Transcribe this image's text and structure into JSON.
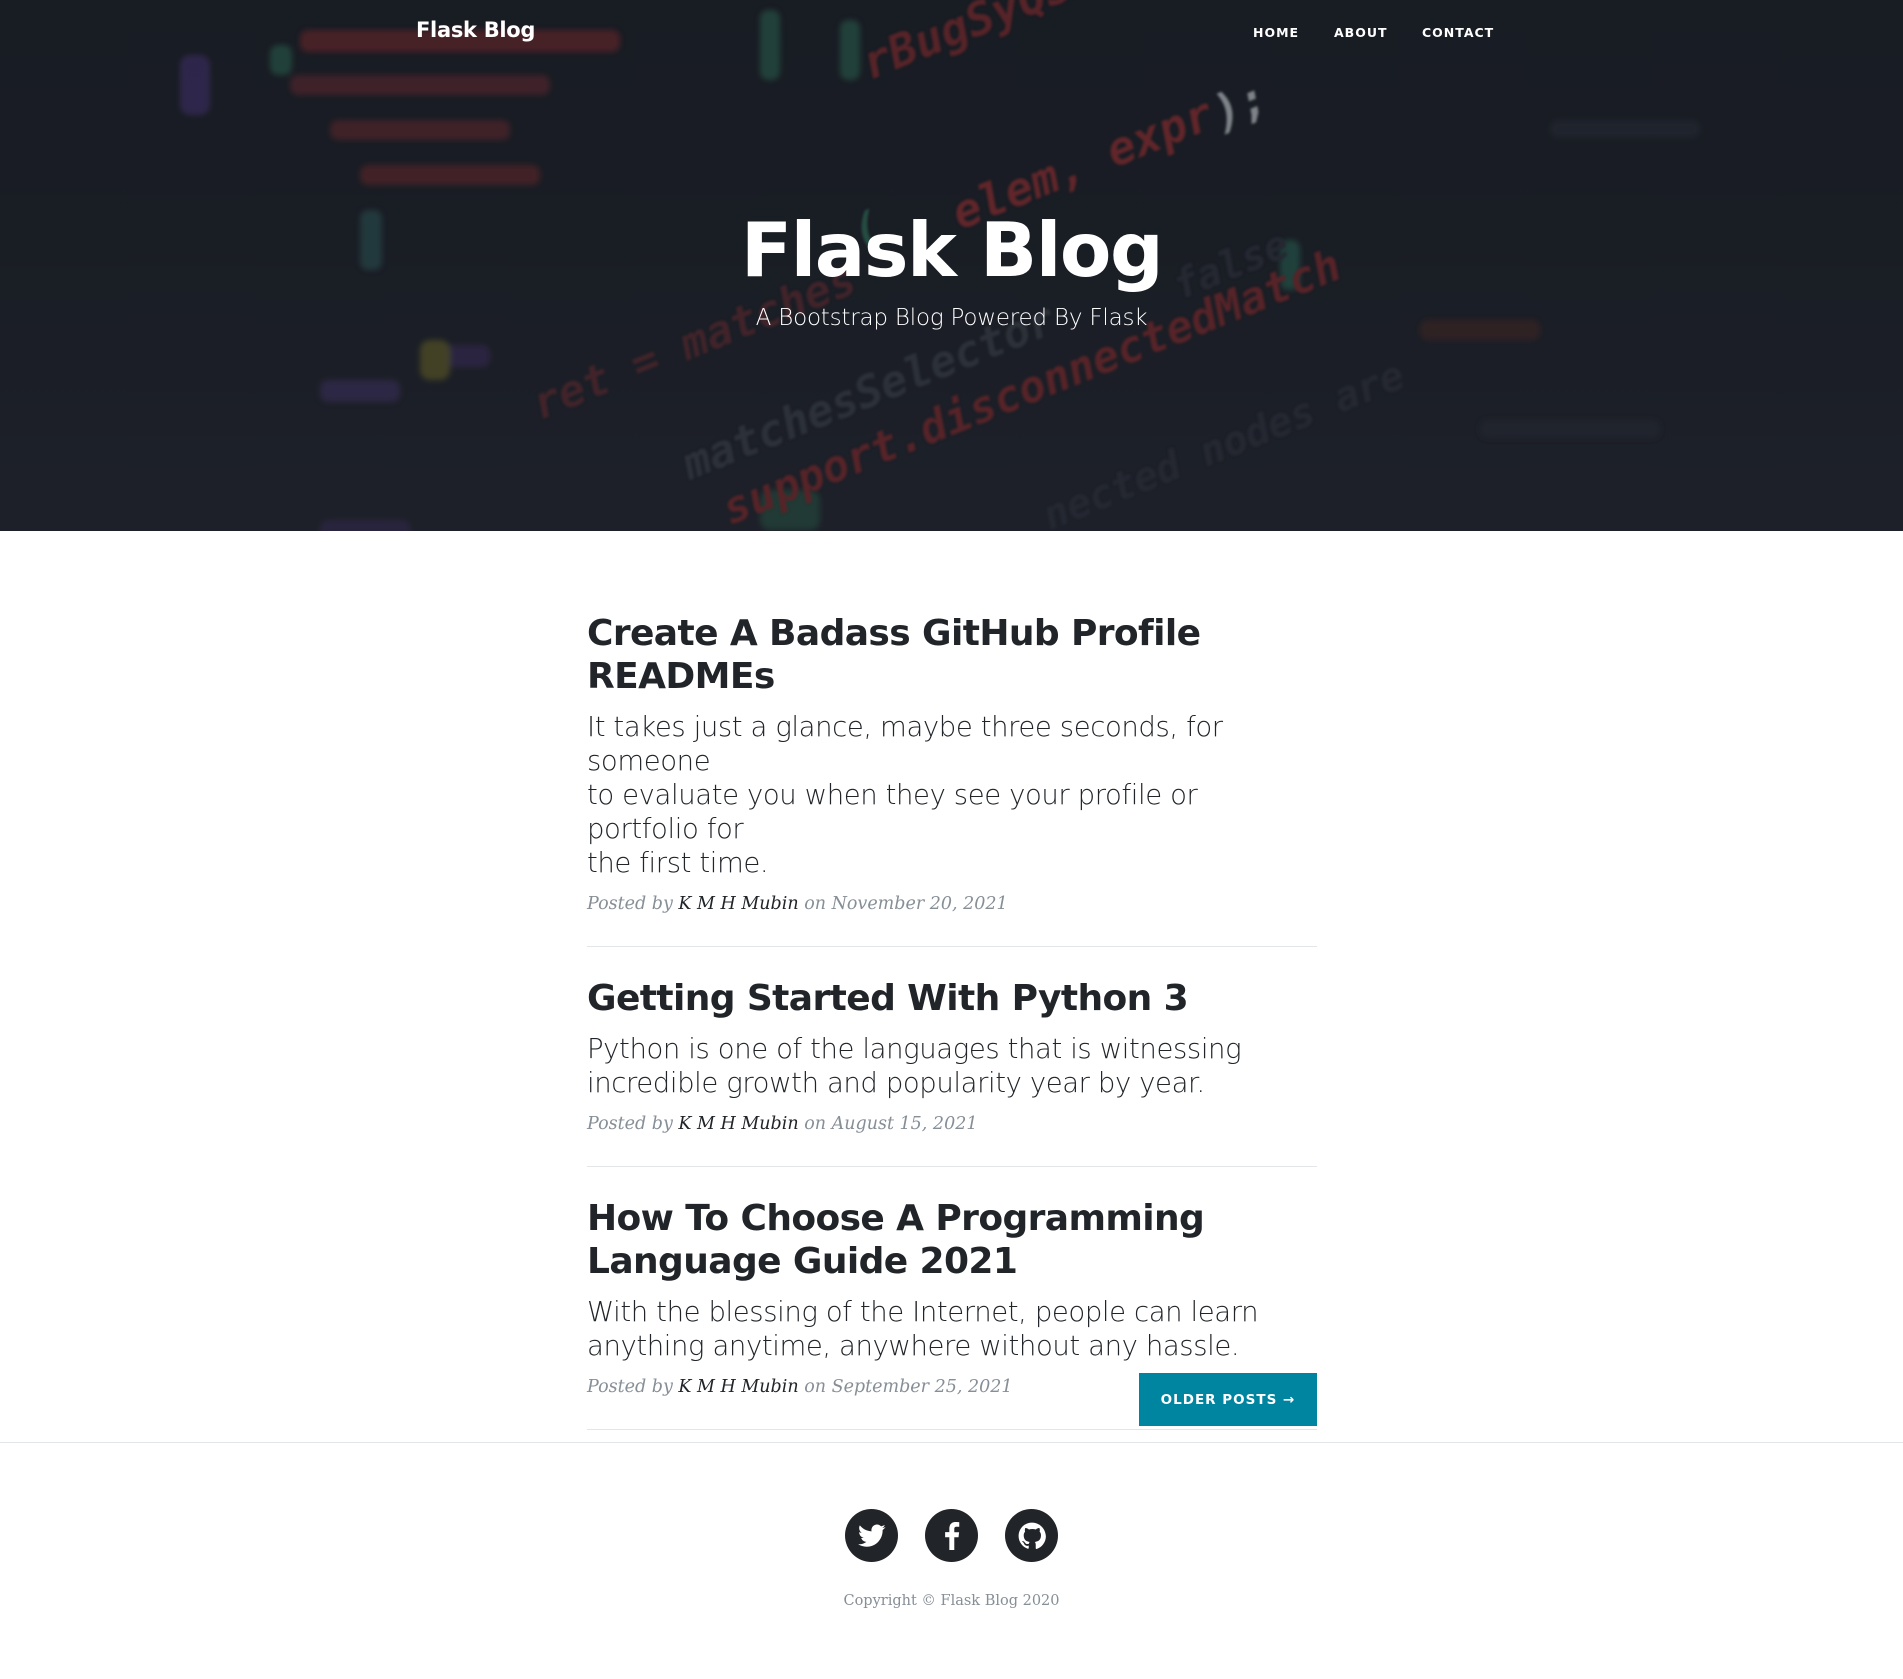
{
  "navbar": {
    "brand": "Flask Blog",
    "links": [
      "HOME",
      "ABOUT",
      "CONTACT"
    ]
  },
  "hero": {
    "title": "Flask Blog",
    "subtitle": "A Bootstrap Blog Powered By Flask"
  },
  "posts": [
    {
      "title_line1": "Create A Badass GitHub Profile",
      "title_line2": "READMEs",
      "subtitle_line1": "It takes just a glance, maybe three seconds, for someone",
      "subtitle_line2": "to evaluate you when they see your profile or portfolio for",
      "subtitle_line3": "the first time.",
      "meta_prefix": "Posted by",
      "author": "K M H Mubin",
      "meta_on": "on",
      "date": "November 20, 2021"
    },
    {
      "title_line1": "Getting Started With Python 3",
      "subtitle_line1": "Python is one of the languages that is witnessing",
      "subtitle_line2": "incredible growth and popularity year by year.",
      "meta_prefix": "Posted by",
      "author": "K M H Mubin",
      "meta_on": "on",
      "date": "August 15, 2021"
    },
    {
      "title_line1": "How To Choose A Programming",
      "title_line2": "Language Guide 2021",
      "subtitle_line1": "With the blessing of the Internet, people can learn",
      "subtitle_line2": "anything anytime, anywhere without any hassle.",
      "meta_prefix": "Posted by",
      "author": "K M H Mubin",
      "meta_on": "on",
      "date": "September 25, 2021"
    }
  ],
  "pager": {
    "older_label": "OLDER POSTS →"
  },
  "footer": {
    "social_icons": [
      "twitter-icon",
      "facebook-icon",
      "github-icon"
    ],
    "copyright": "Copyright © Flask Blog 2020"
  },
  "colors": {
    "accent": "#0085a1",
    "text": "#212529",
    "muted": "#868e96"
  }
}
